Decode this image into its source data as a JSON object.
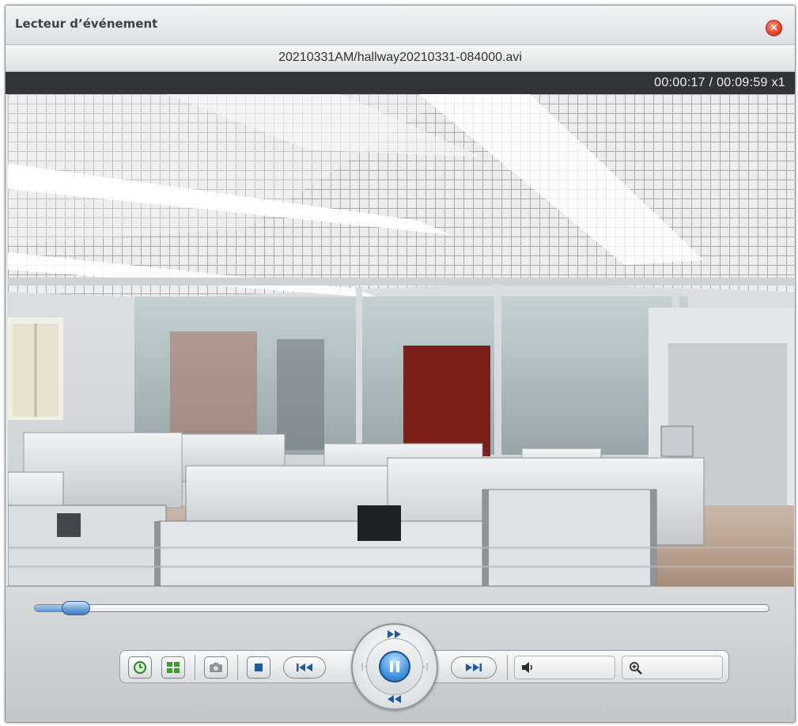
{
  "window": {
    "title": "Lecteur d’événement",
    "close_label": "×"
  },
  "file": {
    "name": "20210331AM/hallway20210331-084000.avi"
  },
  "playback": {
    "time_readout": "00:00:17 / 00:09:59  x1",
    "position_fraction": 0.056
  },
  "toolbar": {
    "buttons": [
      {
        "name": "timeline-button",
        "icon": "clock-icon"
      },
      {
        "name": "layout-button",
        "icon": "grid-icon"
      },
      {
        "name": "snapshot-button",
        "icon": "camera-icon"
      },
      {
        "name": "stop-button",
        "icon": "stop-icon"
      },
      {
        "name": "previous-button",
        "icon": "skip-back-icon"
      },
      {
        "name": "pause-button",
        "icon": "pause-icon"
      },
      {
        "name": "next-button",
        "icon": "skip-forward-icon"
      },
      {
        "name": "speed-up-button",
        "icon": "fast-forward-up-icon"
      },
      {
        "name": "slow-down-button",
        "icon": "fast-rewind-down-icon"
      },
      {
        "name": "volume-control",
        "icon": "speaker-icon"
      },
      {
        "name": "zoom-control",
        "icon": "zoom-in-icon"
      }
    ],
    "accent_color": "#4c9be6"
  }
}
